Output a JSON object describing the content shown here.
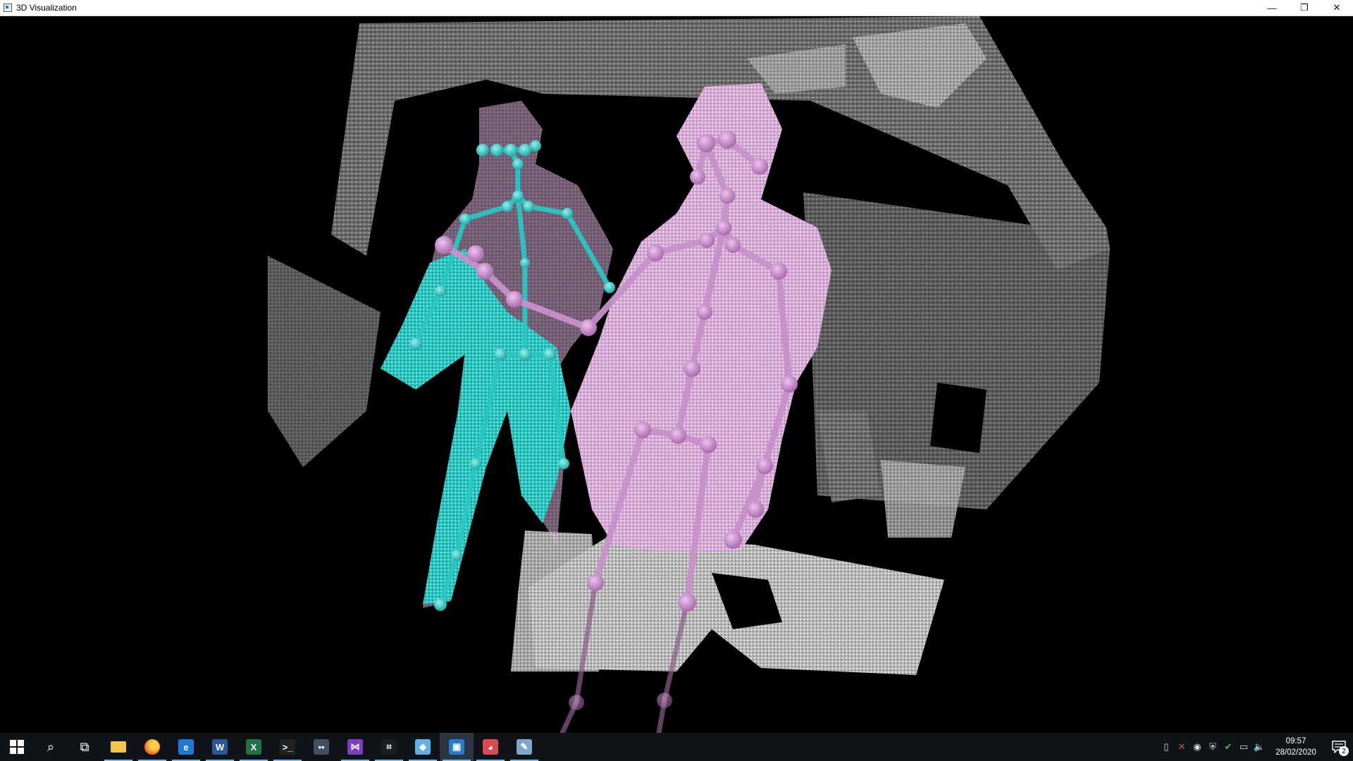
{
  "window": {
    "title": "3D Visualization",
    "minimize_glyph": "—",
    "restore_glyph": "❐",
    "close_glyph": "✕"
  },
  "scene": {
    "background": "#000000",
    "point_cloud_color": "#9a9a9a",
    "body_1_color": "#2fc8c4",
    "body_2_color": "#dcb0dc",
    "body_1_joint_color": "#25bdbb",
    "body_2_joint_color": "#c58ac7"
  },
  "taskbar": {
    "items": [
      {
        "name": "start-button",
        "icon": "windows-logo-icon",
        "glyph": "",
        "color": "#ffffff"
      },
      {
        "name": "search-button",
        "icon": "search-icon",
        "glyph": "⌕",
        "color": "#ffffff"
      },
      {
        "name": "task-view-button",
        "icon": "task-view-icon",
        "glyph": "⧉",
        "color": "#ffffff"
      },
      {
        "name": "file-explorer-button",
        "icon": "folder-icon",
        "glyph": "",
        "color": "#f3c84a",
        "running": true
      },
      {
        "name": "firefox-button",
        "icon": "firefox-icon",
        "glyph": "",
        "color": "#ff7a1a",
        "running": true
      },
      {
        "name": "edge-button",
        "icon": "browser-icon",
        "glyph": "e",
        "color": "#1e78d6",
        "running": true
      },
      {
        "name": "word-button",
        "icon": "word-icon",
        "glyph": "W",
        "color": "#2b579a",
        "running": true
      },
      {
        "name": "excel-button",
        "icon": "excel-icon",
        "glyph": "X",
        "color": "#217346",
        "running": true
      },
      {
        "name": "terminal-button",
        "icon": "terminal-icon",
        "glyph": ">_",
        "color": "#222222",
        "running": true
      },
      {
        "name": "controller-button",
        "icon": "gamepad-icon",
        "glyph": "••",
        "color": "#40505e",
        "running": false
      },
      {
        "name": "visual-studio-button",
        "icon": "visual-studio-icon",
        "glyph": "⋈",
        "color": "#7a3fc4",
        "running": true
      },
      {
        "name": "snipping-button",
        "icon": "crop-icon",
        "glyph": "⌗",
        "color": "#1e1e1e",
        "running": true
      },
      {
        "name": "azure-button",
        "icon": "cube-icon",
        "glyph": "◆",
        "color": "#5fb0e8",
        "running": true
      },
      {
        "name": "3d-visualization-button",
        "icon": "app-window-icon",
        "glyph": "▣",
        "color": "#2a7ad0",
        "running": true,
        "active": true
      },
      {
        "name": "paint-button",
        "icon": "palette-icon",
        "glyph": "◕",
        "color": "#d94a55",
        "running": true
      },
      {
        "name": "tool-button",
        "icon": "wrench-icon",
        "glyph": "✎",
        "color": "#7fa7c9",
        "running": true
      }
    ]
  },
  "tray": {
    "icons": [
      {
        "name": "usb-icon",
        "glyph": "▯"
      },
      {
        "name": "security-x-icon",
        "glyph": "✕"
      },
      {
        "name": "globe-icon",
        "glyph": "◉"
      },
      {
        "name": "shield-icon",
        "glyph": "⛨"
      },
      {
        "name": "check-shield-icon",
        "glyph": "✔"
      },
      {
        "name": "network-icon",
        "glyph": "▭"
      },
      {
        "name": "volume-icon",
        "glyph": "🔈"
      }
    ],
    "time": "09:57",
    "date": "28/02/2020",
    "notification_count": "2"
  }
}
